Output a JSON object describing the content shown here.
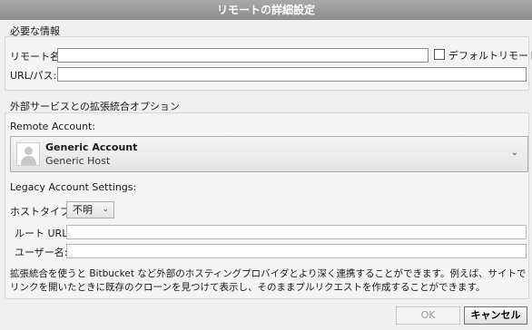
{
  "window": {
    "title": "リモートの詳細設定"
  },
  "required": {
    "group_title": "必要な情報",
    "remote_name_label": "リモート名:",
    "remote_name_value": "",
    "default_remote_label": "デフォルトリモート",
    "default_remote_checked": false,
    "url_label": "URL/パス:",
    "url_value": ""
  },
  "integration": {
    "group_title": "外部サービスとの拡張統合オプション",
    "remote_account_label": "Remote Account:",
    "account": {
      "name": "Generic Account",
      "host": "Generic Host",
      "icon": "avatar-icon"
    },
    "legacy_label": "Legacy Account Settings:",
    "host_type_label": "ホストタイプ:",
    "host_type_value": "不明",
    "root_url_label": "ルート URL:",
    "root_url_value": "",
    "username_label": "ユーザー名:",
    "username_value": "",
    "description": "拡張統合を使うと Bitbucket など外部のホスティングプロバイダとより深く連携することができます。例えば、サイトでリンクを開いたときに既存のクローンを見つけて表示し、そのままプルリクエストを作成することができます。"
  },
  "buttons": {
    "ok": "OK",
    "cancel": "キャンセル"
  },
  "colors": {
    "titlebar": "#8c8c8c",
    "window_bg": "#f0f0f0"
  }
}
